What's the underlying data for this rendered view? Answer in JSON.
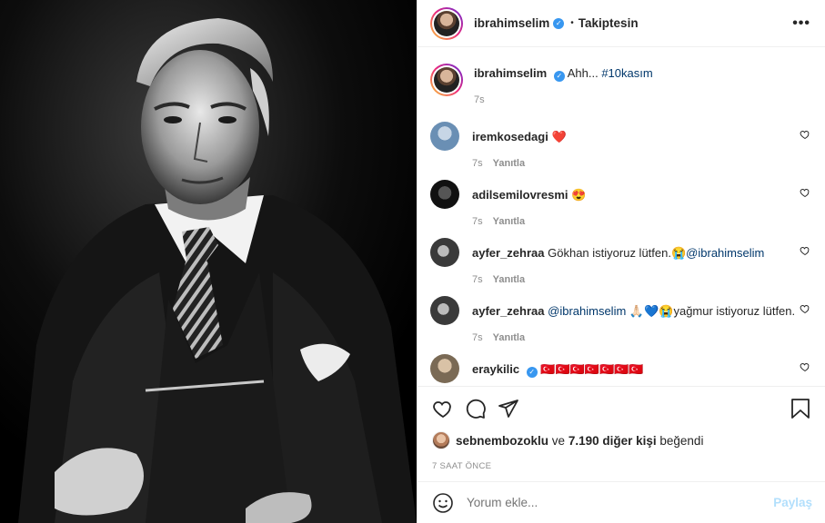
{
  "header": {
    "username": "ibrahimselim",
    "follow_status": "Takiptesin",
    "more_label": "•••"
  },
  "caption": {
    "username": "ibrahimselim",
    "text": "Ahh...",
    "hashtag": "#10kasım",
    "time": "7s"
  },
  "comments": [
    {
      "username": "iremkosedagi",
      "text": "❤️",
      "mention": "",
      "text_after": "",
      "time": "7s",
      "reply": "Yanıtla",
      "verified": false,
      "avatar_color": "#6a8fb4"
    },
    {
      "username": "adilsemilovresmi",
      "text": "😍",
      "mention": "",
      "text_after": "",
      "time": "7s",
      "reply": "Yanıtla",
      "verified": false,
      "avatar_color": "#1a1a1a"
    },
    {
      "username": "ayfer_zehraa",
      "text": "Gökhan istiyoruz lütfen.😭",
      "mention": "@ibrahimselim",
      "text_after": "",
      "time": "7s",
      "reply": "Yanıtla",
      "verified": false,
      "avatar_color": "#3a3a3a"
    },
    {
      "username": "ayfer_zehraa",
      "text": "",
      "mention": "@ibrahimselim",
      "text_after": " 🙏🏻💙😭yağmur istiyoruz lütfen.",
      "time": "7s",
      "reply": "Yanıtla",
      "verified": false,
      "avatar_color": "#3a3a3a"
    },
    {
      "username": "eraykilic",
      "text": "🇹🇷🇹🇷🇹🇷🇹🇷🇹🇷🇹🇷🇹🇷",
      "mention": "",
      "text_after": "",
      "time": "",
      "reply": "",
      "verified": true,
      "avatar_color": "#7a6a55"
    }
  ],
  "likes": {
    "first_user": "sebnembozoklu",
    "connector": "ve",
    "others": "7.190 diğer kişi",
    "suffix": "beğendi"
  },
  "post_time": "7 SAAT ÖNCE",
  "add_comment": {
    "placeholder": "Yorum ekle...",
    "post_label": "Paylaş"
  },
  "colors": {
    "verified": "#3897f0",
    "heart_red": "#ed4956",
    "link": "#00376b",
    "muted": "#8e8e8e",
    "post_disabled": "#b2dffc"
  }
}
